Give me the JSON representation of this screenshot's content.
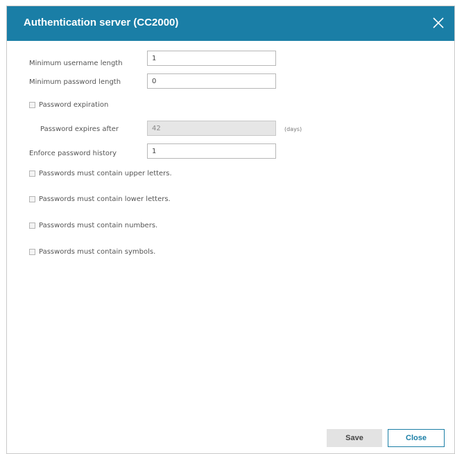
{
  "dialog": {
    "title": "Authentication server (CC2000)",
    "close_icon": "close-icon"
  },
  "fields": {
    "min_username": {
      "label": "Minimum username length",
      "value": "1"
    },
    "min_password": {
      "label": "Minimum password length",
      "value": "0"
    },
    "password_expires": {
      "label": "Password expires after",
      "value": "42",
      "unit": "(days)"
    },
    "password_history": {
      "label": "Enforce password history",
      "value": "1"
    }
  },
  "checkboxes": {
    "expiration": "Password expiration",
    "upper": "Passwords must contain upper letters.",
    "lower": "Passwords must contain lower letters.",
    "numbers": "Passwords must contain numbers.",
    "symbols": "Passwords must contain symbols."
  },
  "buttons": {
    "save": "Save",
    "close": "Close"
  },
  "colors": {
    "header": "#1a7ea6",
    "accent": "#1a7ea6"
  }
}
